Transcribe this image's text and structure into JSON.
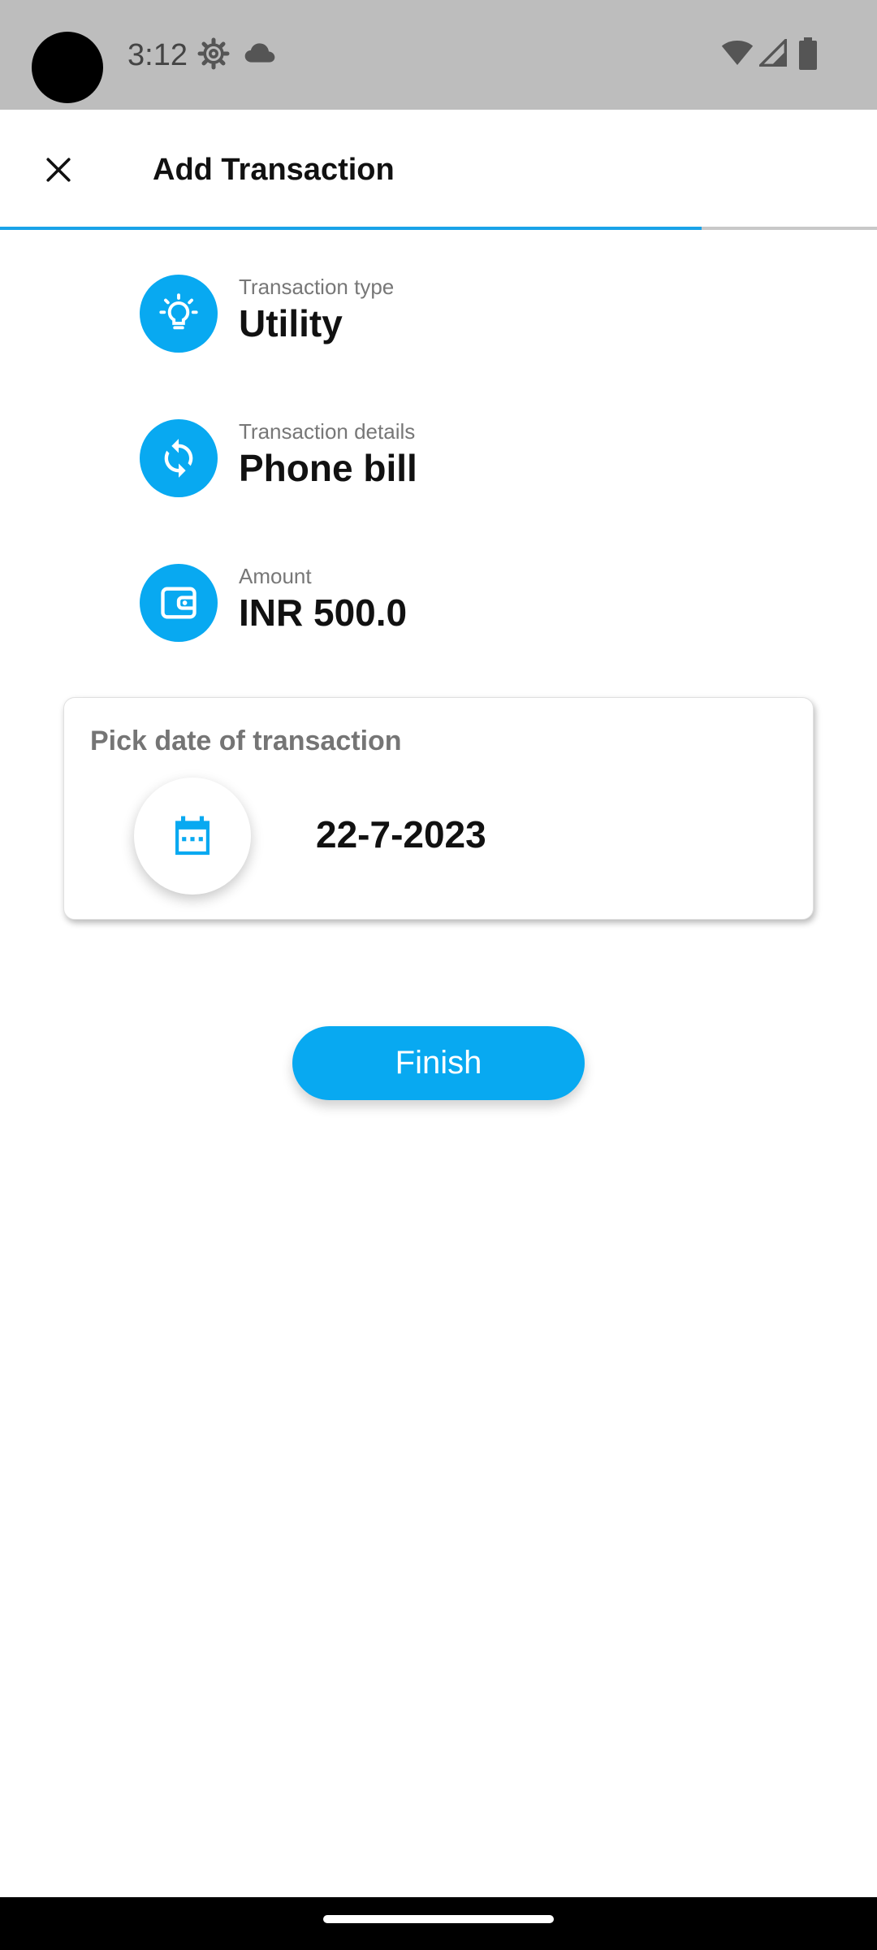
{
  "status_bar": {
    "time": "3:12",
    "icons": [
      "settings-icon",
      "cloud-icon",
      "wifi-icon",
      "signal-icon",
      "battery-icon"
    ]
  },
  "app_bar": {
    "title": "Add Transaction",
    "close_icon": "close-icon",
    "progress_fraction": 0.8
  },
  "details": [
    {
      "icon": "lightbulb-icon",
      "label": "Transaction type",
      "value": "Utility"
    },
    {
      "icon": "refresh-icon",
      "label": "Transaction details",
      "value": "Phone bill"
    },
    {
      "icon": "wallet-icon",
      "label": "Amount",
      "value": "INR 500.0"
    }
  ],
  "date_card": {
    "title": "Pick date of transaction",
    "date": "22-7-2023",
    "icon": "calendar-icon"
  },
  "finish_label": "Finish",
  "colors": {
    "accent": "#08a9f1",
    "status_bar": "#bdbdbd",
    "progress": "#1aa3e8"
  }
}
